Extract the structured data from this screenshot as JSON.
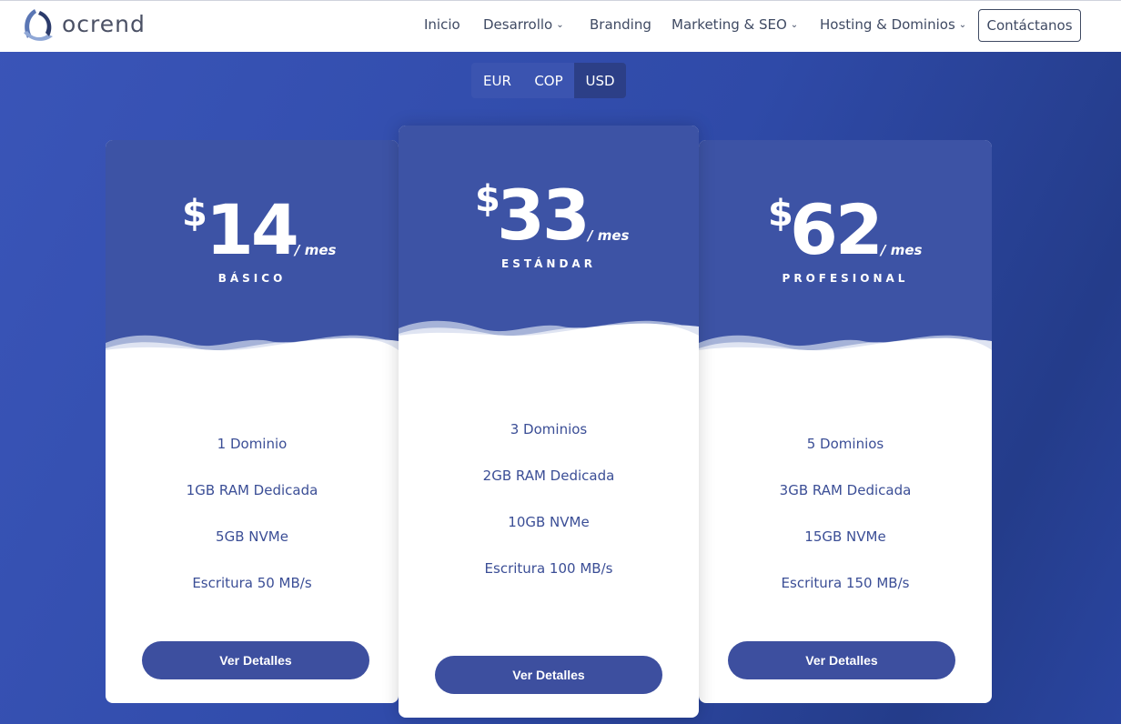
{
  "header": {
    "logo_text": "ocrend",
    "nav": [
      {
        "label": "Inicio",
        "has_dropdown": false
      },
      {
        "label": "Desarrollo",
        "has_dropdown": true
      },
      {
        "label": "Branding",
        "has_dropdown": false
      },
      {
        "label": "Marketing & SEO",
        "has_dropdown": true
      },
      {
        "label": "Hosting & Dominios",
        "has_dropdown": true
      }
    ],
    "contact_label": "Contáctanos"
  },
  "currency": {
    "options": [
      "EUR",
      "COP",
      "USD"
    ],
    "selected": "USD"
  },
  "plans": [
    {
      "currency_symbol": "$",
      "price": "14",
      "period": "/ mes",
      "name": "BÁSICO",
      "features": [
        "1 Dominio",
        "1GB RAM Dedicada",
        "5GB NVMe",
        "Escritura 50 MB/s"
      ],
      "button_label": "Ver Detalles"
    },
    {
      "currency_symbol": "$",
      "price": "33",
      "period": "/ mes",
      "name": "ESTÁNDAR",
      "features": [
        "3 Dominios",
        "2GB RAM Dedicada",
        "10GB NVMe",
        "Escritura 100 MB/s"
      ],
      "button_label": "Ver Detalles",
      "featured": true
    },
    {
      "currency_symbol": "$",
      "price": "62",
      "period": "/ mes",
      "name": "PROFESIONAL",
      "features": [
        "5 Dominios",
        "3GB RAM Dedicada",
        "15GB NVMe",
        "Escritura 150 MB/s"
      ],
      "button_label": "Ver Detalles"
    }
  ],
  "colors": {
    "background": "#2f4aa8",
    "card_header": "#3d53a5",
    "button": "#3d4f9f",
    "feature_text": "#3b4e96",
    "currency_active": "#2c3f87"
  }
}
